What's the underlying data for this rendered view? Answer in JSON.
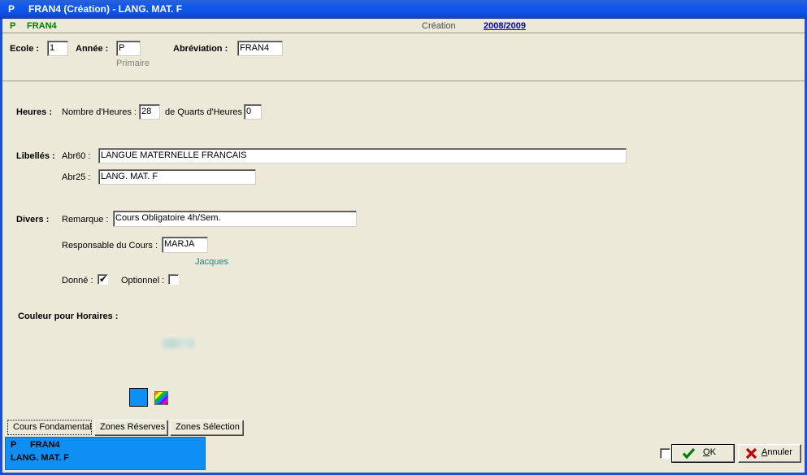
{
  "window": {
    "title": "FRAN4 (Création) - LANG. MAT. F",
    "title_mark": "P"
  },
  "subheader": {
    "code_mark": "P",
    "code": "FRAN4",
    "mode": "Création",
    "school_year": "2008/2009"
  },
  "top_panel": {
    "ecole_label": "Ecole :",
    "ecole_value": "1",
    "annee_label": "Année :",
    "annee_value": "P",
    "annee_hint": "Primaire",
    "abreviation_label": "Abréviation :",
    "abreviation_value": "FRAN4"
  },
  "heures": {
    "section_label": "Heures :",
    "nombre_label": "Nombre d'Heures :",
    "nombre_value": "28",
    "quarts_label": "de Quarts d'Heures :",
    "quarts_value": "0"
  },
  "libelles": {
    "section_label": "Libellés :",
    "abr60_label": "Abr60 :",
    "abr60_value": "LANGUE MATERNELLE FRANCAIS",
    "abr25_label": "Abr25 :",
    "abr25_value": "LANG. MAT. F"
  },
  "divers": {
    "section_label": "Divers :",
    "remarque_label": "Remarque :",
    "remarque_value": "Cours Obligatoire 4h/Sem.",
    "responsable_label": "Responsable du Cours :",
    "responsable_value": "MARJA",
    "responsable_name": "Jacques",
    "donne_label": "Donné :",
    "donne_checked": "✔",
    "optionnel_label": "Optionnel :",
    "optionnel_checked": ""
  },
  "couleur": {
    "label": "Couleur pour Horaires :",
    "swatch_color": "#0d8ff4",
    "palette_icon": "palette-icon"
  },
  "tabs": [
    {
      "label": "Cours Fondamental",
      "active": true
    },
    {
      "label": "Zones Réserves",
      "active": false
    },
    {
      "label": "Zones Sélection",
      "active": false
    }
  ],
  "status": {
    "mark": "P",
    "code": "FRAN4",
    "label": "LANG. MAT. F"
  },
  "buttons": {
    "ok": "OK",
    "ok_accel": "O",
    "ok_rest": "K",
    "cancel": "Annuler",
    "cancel_accel": "A",
    "cancel_rest": "nnuler"
  },
  "colors": {
    "titlebar": "#1158ec",
    "form_bg": "#ece9d8",
    "accent_green": "#008000",
    "link_blue": "#0000c0",
    "status_blue": "#0d8ff4",
    "teal_text": "#1a8a7a"
  }
}
